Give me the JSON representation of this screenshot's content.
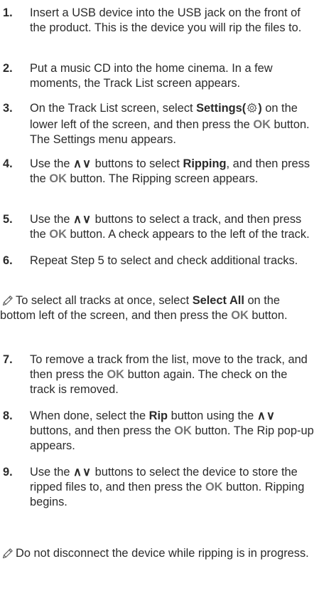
{
  "steps": [
    {
      "num": "1.",
      "parts": [
        {
          "t": "Insert a USB device into the USB jack on the front of the product. This is the device you will rip the files to."
        }
      ]
    },
    {
      "num": "2.",
      "parts": [
        {
          "t": "Put a music CD into the home cinema. In a few moments, the Track List screen appears."
        }
      ]
    },
    {
      "num": "3.",
      "parts": [
        {
          "t": "On the Track List screen, select "
        },
        {
          "t": "Settings(",
          "s": "b"
        },
        {
          "icon": "gear-icon"
        },
        {
          "t": ")",
          "s": "b"
        },
        {
          "t": " on the lower left of the screen, and then press the "
        },
        {
          "t": "OK",
          "s": "ok"
        },
        {
          "t": " button. The Settings menu appears."
        }
      ]
    },
    {
      "num": "4.",
      "parts": [
        {
          "t": "Use the "
        },
        {
          "t": "∧∨",
          "s": "arr"
        },
        {
          "t": " buttons to select "
        },
        {
          "t": "Ripping",
          "s": "b"
        },
        {
          "t": ", and then press the "
        },
        {
          "t": "OK",
          "s": "ok"
        },
        {
          "t": " button. The Ripping screen appears."
        }
      ]
    },
    {
      "num": "5.",
      "parts": [
        {
          "t": "Use the "
        },
        {
          "t": "∧∨",
          "s": "arr"
        },
        {
          "t": " buttons to select a track, and then press the "
        },
        {
          "t": "OK",
          "s": "ok"
        },
        {
          "t": " button. A check appears to the left of the track."
        }
      ]
    },
    {
      "num": "6.",
      "parts": [
        {
          "t": "Repeat Step 5 to select and check additional tracks."
        }
      ]
    },
    {
      "num": "7.",
      "parts": [
        {
          "t": "To remove a track from the list, move to the track, and then press the "
        },
        {
          "t": "OK",
          "s": "ok"
        },
        {
          "t": " button again. The check on the track is removed."
        }
      ]
    },
    {
      "num": "8.",
      "parts": [
        {
          "t": "When done, select the "
        },
        {
          "t": "Rip",
          "s": "b"
        },
        {
          "t": " button using the "
        },
        {
          "t": "∧∨",
          "s": "arr"
        },
        {
          "t": " buttons, and then press the "
        },
        {
          "t": "OK",
          "s": "ok"
        },
        {
          "t": " button. The Rip pop-up appears."
        }
      ]
    },
    {
      "num": "9.",
      "parts": [
        {
          "t": "Use the "
        },
        {
          "t": "∧∨",
          "s": "arr"
        },
        {
          "t": " buttons to select the device to store the ripped files to, and then press the "
        },
        {
          "t": "OK",
          "s": "ok"
        },
        {
          "t": " button. Ripping begins."
        }
      ]
    }
  ],
  "notes": [
    {
      "icon": "pencil-note-icon",
      "parts": [
        {
          "t": "To select all tracks at once, select "
        },
        {
          "t": "Select All",
          "s": "b"
        },
        {
          "t": " on the bottom left of the screen, and then press the "
        },
        {
          "t": "OK",
          "s": "ok"
        },
        {
          "t": " button."
        }
      ]
    },
    {
      "icon": "pencil-note-icon",
      "parts": [
        {
          "t": "Do not disconnect the device while ripping is in progress."
        }
      ]
    }
  ],
  "colors": {
    "text": "#2b2b2b",
    "ok": "#757575"
  }
}
